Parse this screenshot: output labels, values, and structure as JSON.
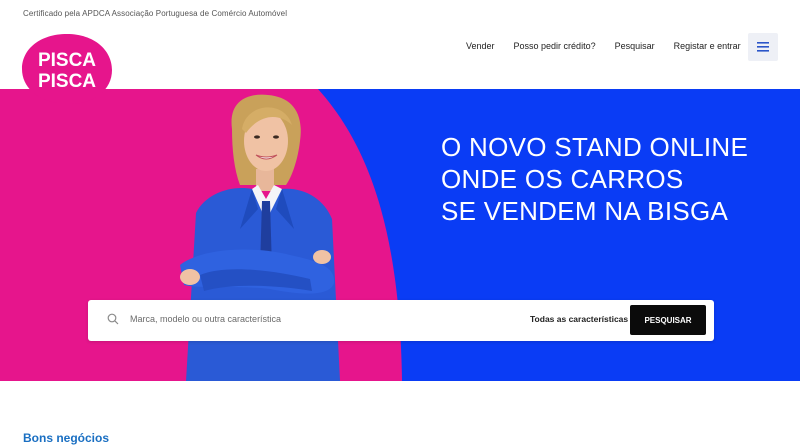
{
  "header": {
    "certification": "Certificado pela APDCA Associação Portuguesa de Comércio Automóvel",
    "logo": {
      "line1": "PISCA",
      "line2": "PISCA",
      "color": "#e6158c"
    },
    "nav": [
      {
        "label": "Vender"
      },
      {
        "label": "Posso pedir crédito?"
      },
      {
        "label": "Pesquisar"
      },
      {
        "label": "Registar e entrar"
      }
    ],
    "menu_icon": "hamburger-icon"
  },
  "hero": {
    "headline": [
      "O NOVO STAND ONLINE",
      "ONDE OS CARROS",
      "SE VENDEM NA BISGA"
    ],
    "colors": {
      "pink": "#e6158c",
      "blue": "#0a3cf5"
    }
  },
  "search": {
    "placeholder": "Marca, modelo ou outra característica",
    "features_label": "Todas as características",
    "button_label": "PESQUISAR",
    "icon": "search-icon"
  },
  "sections": {
    "deals_title": "Bons negócios"
  }
}
